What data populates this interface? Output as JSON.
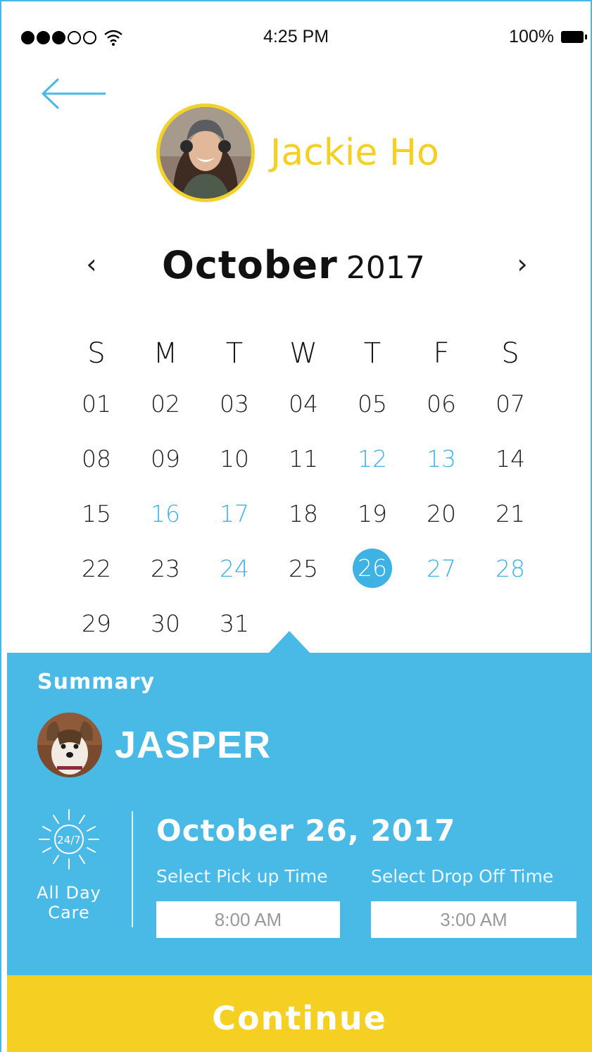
{
  "status_bar": {
    "time": "4:25 PM",
    "battery": "100%",
    "signal_icons": "signal-dots-icon",
    "wifi_icon": "wifi-icon",
    "battery_icon": "battery-icon"
  },
  "header": {
    "back_icon": "arrow-left-icon",
    "user_name": "Jackie Ho"
  },
  "calendar": {
    "month": "October",
    "year": "2017",
    "prev_icon": "chevron-left-icon",
    "next_icon": "chevron-right-icon",
    "prev_label": "‹",
    "next_label": "›",
    "weekdays": [
      "S",
      "M",
      "T",
      "W",
      "T",
      "F",
      "S"
    ],
    "weeks": [
      [
        "01",
        "02",
        "03",
        "04",
        "05",
        "06",
        "07"
      ],
      [
        "08",
        "09",
        "10",
        "11",
        "12",
        "13",
        "14"
      ],
      [
        "15",
        "16",
        "17",
        "18",
        "19",
        "20",
        "21"
      ],
      [
        "22",
        "23",
        "24",
        "25",
        "26",
        "27",
        "28"
      ],
      [
        "29",
        "30",
        "31",
        "",
        "",
        "",
        ""
      ]
    ],
    "highlighted_days": [
      "12",
      "13",
      "16",
      "17",
      "24",
      "27",
      "28"
    ],
    "selected_day": "26"
  },
  "summary": {
    "title": "Summary",
    "pet_name": "JASPER",
    "care_icon_text": "24/7",
    "care_label_line1": "All Day",
    "care_label_line2": "Care",
    "date": "October 26, 2017",
    "pickup_label": "Select Pick up Time",
    "dropoff_label": "Select Drop Off Time",
    "pickup_time": "8:00 AM",
    "dropoff_time": "3:00 AM"
  },
  "actions": {
    "continue_label": "Continue"
  },
  "colors": {
    "accent_blue": "#49b9e6",
    "accent_yellow": "#f5cf21",
    "text_dark": "#111111"
  }
}
